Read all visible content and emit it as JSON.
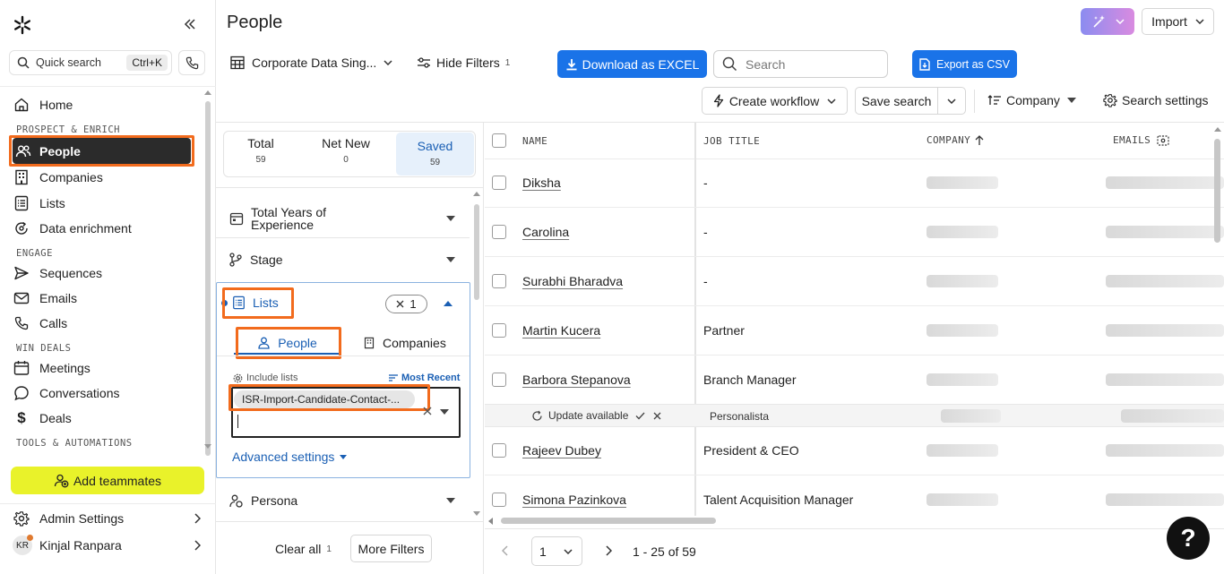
{
  "header": {
    "title": "People",
    "import_label": "Import"
  },
  "sidebar": {
    "quick_search_label": "Quick search",
    "quick_search_shortcut": "Ctrl+K",
    "sections": {
      "prospect": "PROSPECT & ENRICH",
      "engage": "ENGAGE",
      "win": "WIN DEALS",
      "tools": "TOOLS & AUTOMATIONS"
    },
    "items": {
      "home": "Home",
      "people": "People",
      "companies": "Companies",
      "lists": "Lists",
      "data_enrichment": "Data enrichment",
      "sequences": "Sequences",
      "emails": "Emails",
      "calls": "Calls",
      "meetings": "Meetings",
      "conversations": "Conversations",
      "deals": "Deals"
    },
    "add_teammates_label": "Add teammates",
    "admin_settings_label": "Admin Settings",
    "user": {
      "initials": "KR",
      "name": "Kinjal Ranpara"
    }
  },
  "toolbar": {
    "saved_search_name": "Corporate Data Sing...",
    "hide_filters_label": "Hide Filters",
    "hide_filters_count": "1",
    "download_label": "Download as EXCEL",
    "search_placeholder": "Search",
    "export_label": "Export as CSV",
    "create_workflow_label": "Create workflow",
    "save_search_label": "Save search",
    "sort_label": "Company",
    "search_settings_label": "Search settings"
  },
  "filters": {
    "tabs": [
      {
        "label": "Total",
        "count": "59"
      },
      {
        "label": "Net New",
        "count": "0"
      },
      {
        "label": "Saved",
        "count": "59"
      }
    ],
    "total_years_label_1": "Total Years of",
    "total_years_label_2": "Experience",
    "stage_label": "Stage",
    "lists_label": "Lists",
    "lists_badge": "1",
    "lists_subtabs": {
      "people": "People",
      "companies": "Companies"
    },
    "include_lists_label": "Include lists",
    "most_recent_label": "Most Recent",
    "selected_list": "ISR-Import-Candidate-Contact-...",
    "advanced_settings_label": "Advanced settings",
    "persona_label": "Persona",
    "clear_all_label": "Clear all",
    "clear_all_count": "1",
    "more_filters_label": "More Filters"
  },
  "table": {
    "columns": {
      "name": "NAME",
      "job_title": "JOB TITLE",
      "company": "COMPANY",
      "emails": "EMAILS"
    },
    "rows": [
      {
        "name": "Diksha",
        "title": "-"
      },
      {
        "name": "Carolina",
        "title": "-"
      },
      {
        "name": "Surabhi Bharadva",
        "title": "-"
      },
      {
        "name": "Martin Kucera",
        "title": "Partner"
      },
      {
        "name": "Barbora Stepanova",
        "title": "Branch Manager"
      },
      {
        "name": "Rajeev Dubey",
        "title": "President & CEO"
      },
      {
        "name": "Simona Pazinkova",
        "title": "Talent Acquisition Manager"
      }
    ],
    "update_available_label": "Update available",
    "update_title_value": "Personalista"
  },
  "pagination": {
    "page": "1",
    "range_label": "1 - 25 of 59"
  },
  "help": {
    "label": "?"
  },
  "colors": {
    "accent_orange": "#f26b1d",
    "primary_blue": "#1a73e8",
    "add_teammates_yellow": "#e9f22a",
    "active_nav_bg": "#2b2b2b"
  }
}
